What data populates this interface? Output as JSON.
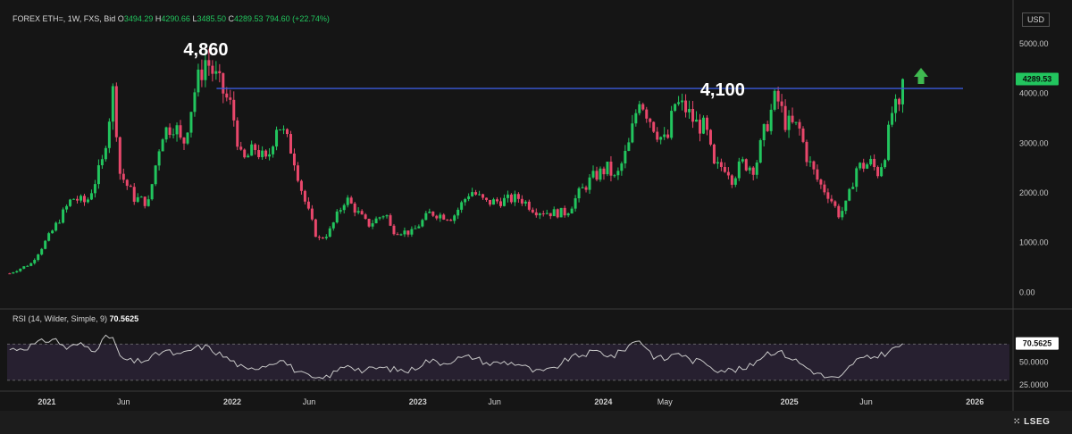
{
  "header": {
    "symbol": "FOREX ETH=, 1W, FXS, Bid",
    "open_label": "O",
    "open": "3494.29",
    "high_label": "H",
    "high": "4290.66",
    "low_label": "L",
    "low": "3485.50",
    "close_label": "C",
    "close": "4289.53",
    "change": "794.60 (+22.74%)"
  },
  "currency": "USD",
  "brand": "LSEG",
  "colors": {
    "up": "#22c55e",
    "down": "#e8476b",
    "level": "#3b5bdb",
    "rsi": "#c8c8c8",
    "rsi_band": "#2a2235",
    "arrow": "#3fb950"
  },
  "icons": {
    "target": "up-arrow-icon"
  },
  "annotations": {
    "peak": "4,860",
    "resistance": "4,100"
  },
  "rsi": {
    "label": "RSI (14, Wilder, Simple, 9)",
    "value": "70.5625",
    "ticks": [
      "70.0000",
      "50.0000",
      "25.0000"
    ],
    "band": [
      30,
      70
    ]
  },
  "chart_data": {
    "type": "candlestick",
    "y_ticks": [
      "0.00",
      "1000.00",
      "2000.00",
      "3000.00",
      "4000.00",
      "5000.00"
    ],
    "ylim": [
      -300,
      5700
    ],
    "last_price": "4289.53",
    "resistance_level": 4100,
    "x_labels": [
      {
        "t": "2021",
        "d": "2021-01-01"
      },
      {
        "t": "Jun",
        "d": "2021-06-01"
      },
      {
        "t": "2022",
        "d": "2022-01-01"
      },
      {
        "t": "Jun",
        "d": "2022-06-01"
      },
      {
        "t": "2023",
        "d": "2023-01-01"
      },
      {
        "t": "Jun",
        "d": "2023-06-01"
      },
      {
        "t": "2024",
        "d": "2024-01-01"
      },
      {
        "t": "May",
        "d": "2024-05-01"
      },
      {
        "t": "2025",
        "d": "2025-01-01"
      },
      {
        "t": "Jun",
        "d": "2025-06-01"
      },
      {
        "t": "2026",
        "d": "2026-01-01"
      }
    ],
    "x_range": [
      "2020-10-15",
      "2026-03-10"
    ],
    "close_path": [
      [
        "2020-10-20",
        380
      ],
      [
        "2020-12-01",
        580
      ],
      [
        "2021-01-10",
        1200
      ],
      [
        "2021-02-20",
        1900
      ],
      [
        "2021-03-20",
        1800
      ],
      [
        "2021-04-20",
        2600
      ],
      [
        "2021-05-12",
        4100
      ],
      [
        "2021-05-25",
        2400
      ],
      [
        "2021-06-22",
        1900
      ],
      [
        "2021-07-20",
        1800
      ],
      [
        "2021-08-15",
        3200
      ],
      [
        "2021-09-10",
        3400
      ],
      [
        "2021-09-25",
        2900
      ],
      [
        "2021-10-20",
        4100
      ],
      [
        "2021-11-10",
        4700
      ],
      [
        "2021-12-05",
        4200
      ],
      [
        "2021-12-31",
        3700
      ],
      [
        "2022-01-20",
        2600
      ],
      [
        "2022-02-15",
        2900
      ],
      [
        "2022-03-10",
        2600
      ],
      [
        "2022-03-31",
        3450
      ],
      [
        "2022-04-30",
        2800
      ],
      [
        "2022-05-20",
        1950
      ],
      [
        "2022-06-18",
        1050
      ],
      [
        "2022-07-10",
        1200
      ],
      [
        "2022-08-12",
        1900
      ],
      [
        "2022-09-05",
        1600
      ],
      [
        "2022-09-25",
        1350
      ],
      [
        "2022-10-30",
        1600
      ],
      [
        "2022-11-10",
        1250
      ],
      [
        "2022-12-20",
        1200
      ],
      [
        "2023-01-25",
        1600
      ],
      [
        "2023-03-10",
        1500
      ],
      [
        "2023-04-15",
        2050
      ],
      [
        "2023-05-15",
        1800
      ],
      [
        "2023-06-20",
        1850
      ],
      [
        "2023-07-20",
        1900
      ],
      [
        "2023-08-20",
        1650
      ],
      [
        "2023-09-20",
        1600
      ],
      [
        "2023-10-20",
        1600
      ],
      [
        "2023-11-15",
        2000
      ],
      [
        "2023-12-10",
        2300
      ],
      [
        "2024-01-10",
        2500
      ],
      [
        "2024-01-25",
        2250
      ],
      [
        "2024-02-20",
        2950
      ],
      [
        "2024-03-12",
        3950
      ],
      [
        "2024-03-30",
        3550
      ],
      [
        "2024-04-20",
        3150
      ],
      [
        "2024-05-05",
        3000
      ],
      [
        "2024-05-20",
        3800
      ],
      [
        "2024-06-10",
        3700
      ],
      [
        "2024-06-30",
        3400
      ],
      [
        "2024-07-20",
        3300
      ],
      [
        "2024-08-06",
        2500
      ],
      [
        "2024-08-30",
        2550
      ],
      [
        "2024-09-10",
        2300
      ],
      [
        "2024-09-30",
        2600
      ],
      [
        "2024-10-25",
        2500
      ],
      [
        "2024-11-12",
        3200
      ],
      [
        "2024-12-06",
        3950
      ],
      [
        "2024-12-25",
        3400
      ],
      [
        "2025-01-20",
        3300
      ],
      [
        "2025-02-05",
        2700
      ],
      [
        "2025-02-28",
        2200
      ],
      [
        "2025-03-20",
        1950
      ],
      [
        "2025-04-09",
        1550
      ],
      [
        "2025-04-25",
        1800
      ],
      [
        "2025-05-12",
        2500
      ],
      [
        "2025-06-10",
        2600
      ],
      [
        "2025-06-25",
        2400
      ],
      [
        "2025-07-12",
        2950
      ],
      [
        "2025-07-20",
        3600
      ],
      [
        "2025-08-01",
        3700
      ],
      [
        "2025-08-09",
        3500
      ],
      [
        "2025-08-15",
        4289.53
      ]
    ],
    "rsi_series": [
      [
        "2020-10-20",
        64
      ],
      [
        "2020-11-20",
        66
      ],
      [
        "2020-12-20",
        72
      ],
      [
        "2021-01-15",
        76
      ],
      [
        "2021-02-10",
        65
      ],
      [
        "2021-03-05",
        70
      ],
      [
        "2021-04-05",
        64
      ],
      [
        "2021-04-25",
        76
      ],
      [
        "2021-05-10",
        79
      ],
      [
        "2021-05-25",
        55
      ],
      [
        "2021-06-20",
        50
      ],
      [
        "2021-07-20",
        53
      ],
      [
        "2021-08-20",
        63
      ],
      [
        "2021-09-20",
        57
      ],
      [
        "2021-10-20",
        66
      ],
      [
        "2021-11-10",
        67
      ],
      [
        "2021-12-10",
        58
      ],
      [
        "2022-01-10",
        48
      ],
      [
        "2022-01-30",
        40
      ],
      [
        "2022-02-20",
        45
      ],
      [
        "2022-03-20",
        49
      ],
      [
        "2022-04-05",
        54
      ],
      [
        "2022-04-30",
        43
      ],
      [
        "2022-05-20",
        36
      ],
      [
        "2022-06-20",
        30
      ],
      [
        "2022-07-20",
        38
      ],
      [
        "2022-08-15",
        48
      ],
      [
        "2022-09-15",
        40
      ],
      [
        "2022-10-15",
        44
      ],
      [
        "2022-11-15",
        42
      ],
      [
        "2022-12-15",
        40
      ],
      [
        "2023-01-20",
        52
      ],
      [
        "2023-02-20",
        49
      ],
      [
        "2023-03-20",
        54
      ],
      [
        "2023-04-20",
        56
      ],
      [
        "2023-05-20",
        48
      ],
      [
        "2023-06-20",
        50
      ],
      [
        "2023-07-20",
        48
      ],
      [
        "2023-08-20",
        39
      ],
      [
        "2023-09-20",
        41
      ],
      [
        "2023-10-25",
        54
      ],
      [
        "2023-11-20",
        58
      ],
      [
        "2023-12-20",
        62
      ],
      [
        "2024-01-20",
        56
      ],
      [
        "2024-02-15",
        66
      ],
      [
        "2024-03-10",
        76
      ],
      [
        "2024-04-10",
        56
      ],
      [
        "2024-05-05",
        53
      ],
      [
        "2024-05-25",
        62
      ],
      [
        "2024-06-20",
        52
      ],
      [
        "2024-07-20",
        50
      ],
      [
        "2024-08-10",
        42
      ],
      [
        "2024-09-10",
        41
      ],
      [
        "2024-10-10",
        43
      ],
      [
        "2024-11-15",
        60
      ],
      [
        "2024-12-10",
        62
      ],
      [
        "2025-01-10",
        53
      ],
      [
        "2025-02-10",
        42
      ],
      [
        "2025-03-10",
        34
      ],
      [
        "2025-04-10",
        31
      ],
      [
        "2025-05-10",
        52
      ],
      [
        "2025-06-10",
        55
      ],
      [
        "2025-07-10",
        60
      ],
      [
        "2025-08-15",
        70.56
      ]
    ]
  }
}
